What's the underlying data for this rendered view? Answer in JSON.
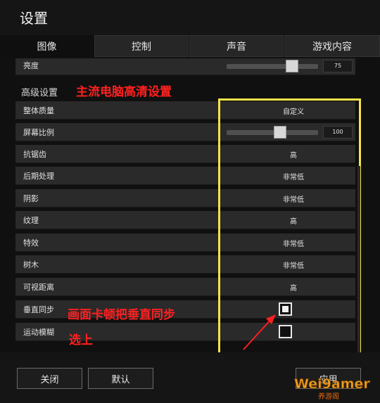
{
  "window": {
    "title": "设置"
  },
  "tabs": [
    {
      "label": "图像",
      "active": true
    },
    {
      "label": "控制",
      "active": false
    },
    {
      "label": "声音",
      "active": false
    },
    {
      "label": "游戏内容",
      "active": false
    }
  ],
  "brightness": {
    "label": "亮度",
    "value": "75",
    "fraction": 0.75
  },
  "section": {
    "title": "高级设置"
  },
  "annotations": {
    "header_note": "主流电脑高清设置",
    "vsync_note_line1": "画面卡顿把垂直同步",
    "vsync_note_line2": "选上"
  },
  "settings": [
    {
      "label": "整体质量",
      "value": "自定义"
    },
    {
      "label": "屏幕比例",
      "value": "100",
      "slider_fraction": 0.6
    },
    {
      "label": "抗锯齿",
      "value": "高"
    },
    {
      "label": "后期处理",
      "value": "非常低"
    },
    {
      "label": "阴影",
      "value": "非常低"
    },
    {
      "label": "纹理",
      "value": "高"
    },
    {
      "label": "特效",
      "value": "非常低"
    },
    {
      "label": "树木",
      "value": "非常低"
    },
    {
      "label": "可视距离",
      "value": "高"
    },
    {
      "label": "垂直同步",
      "checked": true
    },
    {
      "label": "运动模糊",
      "checked": false
    }
  ],
  "footer": {
    "close_label": "关闭",
    "default_label": "默认",
    "apply_label": "应用"
  },
  "watermark": {
    "text_main": "Wei9amer",
    "text_sub": "养游阁"
  },
  "colors": {
    "highlight_box": "#f4e34a",
    "annotation_red": "#ff2020"
  }
}
